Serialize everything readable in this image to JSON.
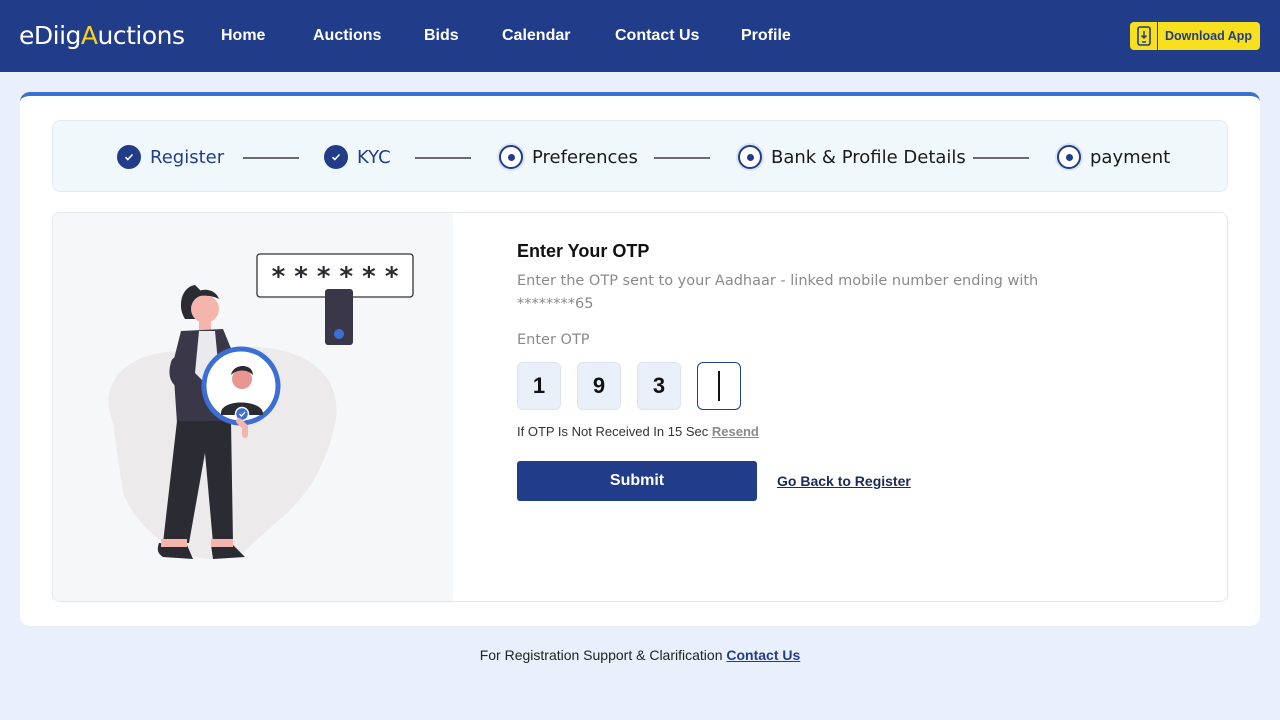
{
  "brand": {
    "name_a": "eDiig ",
    "name_b": "A",
    "name_c": "uctions"
  },
  "nav": [
    "Home",
    "Auctions",
    "Bids",
    "Calendar",
    "Contact Us",
    "Profile"
  ],
  "header": {
    "download_label": "Download App"
  },
  "stepper": {
    "steps": [
      {
        "label": "Register",
        "state": "done"
      },
      {
        "label": "KYC",
        "state": "done"
      },
      {
        "label": "Preferences",
        "state": "todo"
      },
      {
        "label": "Bank & Profile Details",
        "state": "todo"
      },
      {
        "label": "payment",
        "state": "todo"
      }
    ]
  },
  "illustration": {
    "password_mask": "* * * * * *"
  },
  "otp": {
    "title": "Enter Your OTP",
    "description": "Enter the OTP sent to your Aadhaar - linked mobile number ending with ********65",
    "field_label": "Enter OTP",
    "digits": [
      "1",
      "9",
      "3",
      ""
    ],
    "resend_text": "If OTP Is Not Received In 15 Sec",
    "resend_link": "Resend",
    "submit_label": "Submit",
    "back_label": "Go Back to Register"
  },
  "footer": {
    "text": "For Registration Support & Clarification",
    "link": "Contact Us"
  },
  "colors": {
    "primary": "#213d8a",
    "accent": "#f9e01f",
    "page_bg": "#eaf0fb"
  }
}
